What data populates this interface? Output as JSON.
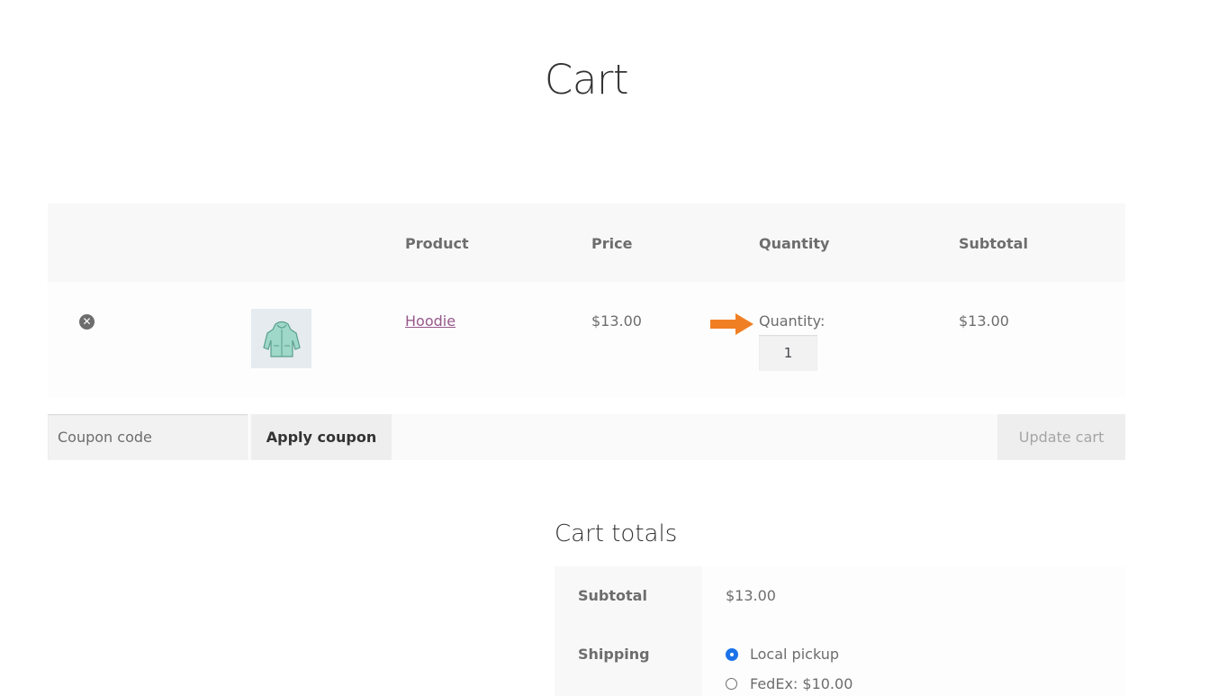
{
  "page": {
    "title": "Cart"
  },
  "cart_table": {
    "headers": {
      "product": "Product",
      "price": "Price",
      "quantity": "Quantity",
      "subtotal": "Subtotal"
    },
    "items": [
      {
        "name": "Hoodie",
        "price": "$13.00",
        "quantity_label": "Quantity:",
        "quantity": "1",
        "subtotal": "$13.00",
        "remove_icon": "remove-circle-x-icon",
        "thumbnail": "hoodie-thumbnail"
      }
    ],
    "annotation_arrow_color": "#f07f23"
  },
  "actions": {
    "coupon_placeholder": "Coupon code",
    "apply_label": "Apply coupon",
    "update_label": "Update cart"
  },
  "totals": {
    "title": "Cart totals",
    "subtotal_label": "Subtotal",
    "subtotal_value": "$13.00",
    "shipping_label": "Shipping",
    "shipping_options": [
      {
        "label": "Local pickup",
        "selected": true
      },
      {
        "label": "FedEx: $10.00",
        "selected": false
      }
    ]
  },
  "colors": {
    "link": "#96588a",
    "radio_selected": "#1a73e8",
    "header_bg": "#f8f8f8"
  }
}
